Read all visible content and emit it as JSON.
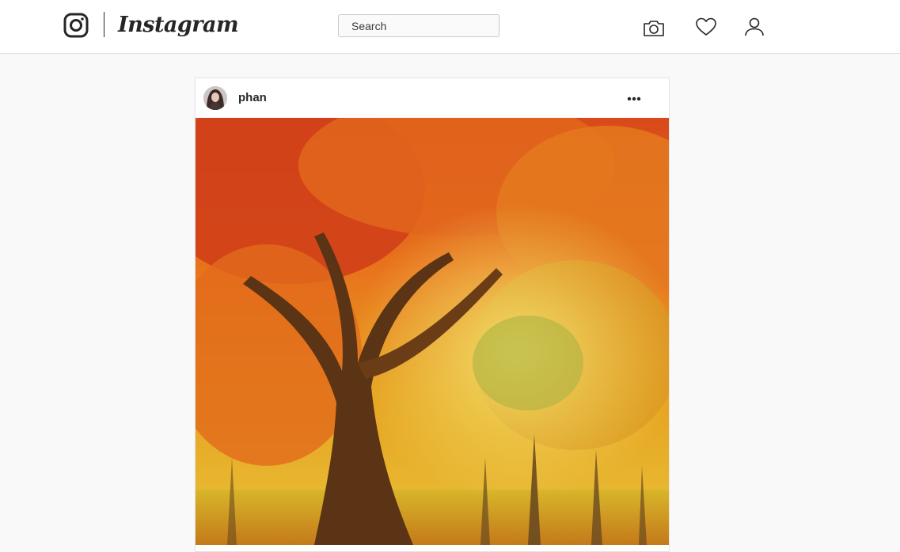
{
  "app": {
    "wordmark": "Instagram"
  },
  "search": {
    "placeholder": "Search",
    "value": ""
  },
  "nav": {
    "icons": [
      "camera-icon",
      "heart-icon",
      "user-icon"
    ]
  },
  "post": {
    "username": "phan",
    "image_description_icon": "autumn-tree-photo"
  },
  "colors": {
    "text": "#262626",
    "border": "#dbdbdb",
    "background": "#f9f9f9"
  }
}
